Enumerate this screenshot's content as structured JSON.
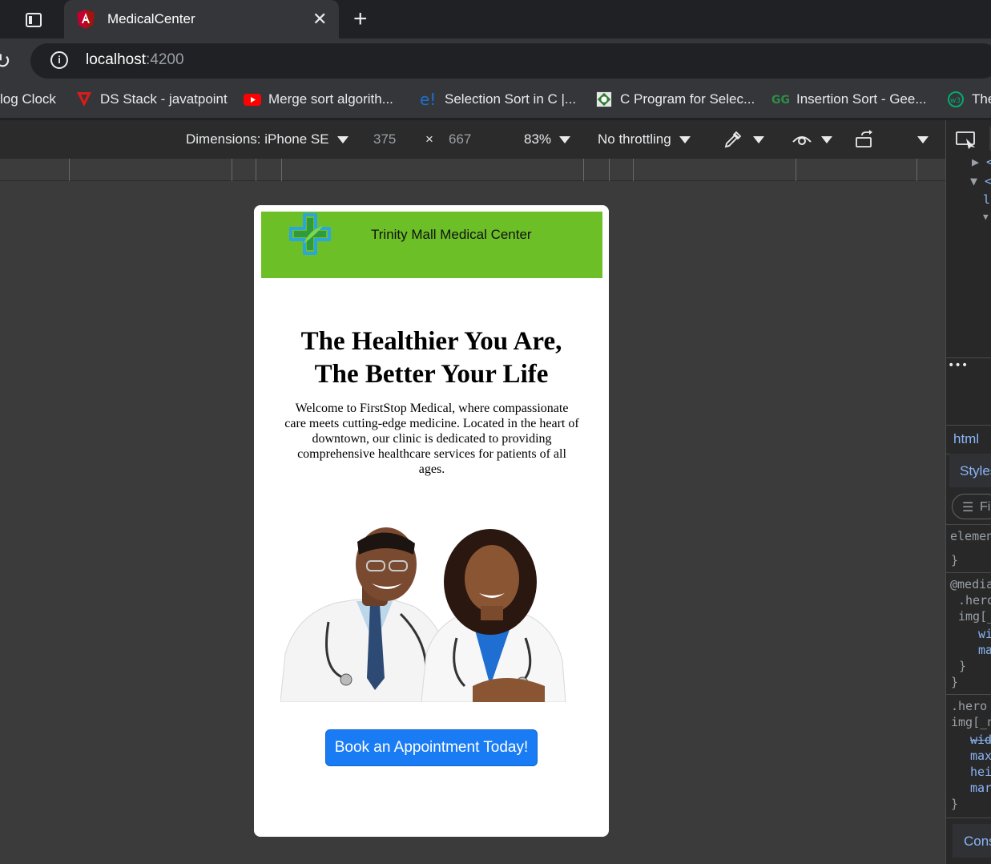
{
  "browser": {
    "tab_title": "MedicalCenter",
    "url_host": "localhost",
    "url_port": ":4200"
  },
  "bookmarks": [
    {
      "label": "log Clock",
      "icon": "clock-icon"
    },
    {
      "label": "DS Stack - javatpoint",
      "icon": "javatpoint-icon"
    },
    {
      "label": "Merge sort algorith...",
      "icon": "youtube-icon"
    },
    {
      "label": "Selection Sort in C |...",
      "icon": "e-icon"
    },
    {
      "label": "C Program for Selec...",
      "icon": "gear-badge-icon"
    },
    {
      "label": "Insertion Sort - Gee...",
      "icon": "gfg-icon"
    },
    {
      "label": "The",
      "icon": "w3-icon"
    }
  ],
  "device_toolbar": {
    "dimensions_label": "Dimensions: iPhone SE",
    "width": "375",
    "times": "×",
    "height": "667",
    "zoom": "83%",
    "throttling": "No throttling"
  },
  "site": {
    "header_title": "Trinity Mall Medical Center",
    "heading_line1": "The Healthier You Are,",
    "heading_line2": "The Better Your Life",
    "intro": "Welcome to FirstStop Medical, where compassionate care meets cutting-edge medicine. Located in the heart of downtown, our clinic is dedicated to providing comprehensive healthcare services for patients of all ages.",
    "cta_label": "Book an Appointment Today!",
    "colors": {
      "header_bg": "#6dbf27",
      "cta_bg": "#1a7cf5"
    }
  },
  "devtools": {
    "breadcrumb": "html",
    "styles_tab": "Styles",
    "filter_label": "Fi",
    "element_label": "elemen",
    "media_label": "@media",
    "hero_rule": ".hero",
    "img_rule": "img[_",
    "prop_wi": "wi",
    "prop_ma": "ma",
    "hero_rule2": ".hero",
    "img_rule2": "img[_n",
    "prop_wid": "wid",
    "prop_max": "max",
    "prop_hei": "hei",
    "prop_mar": "mar",
    "console_tab": "Cons"
  }
}
